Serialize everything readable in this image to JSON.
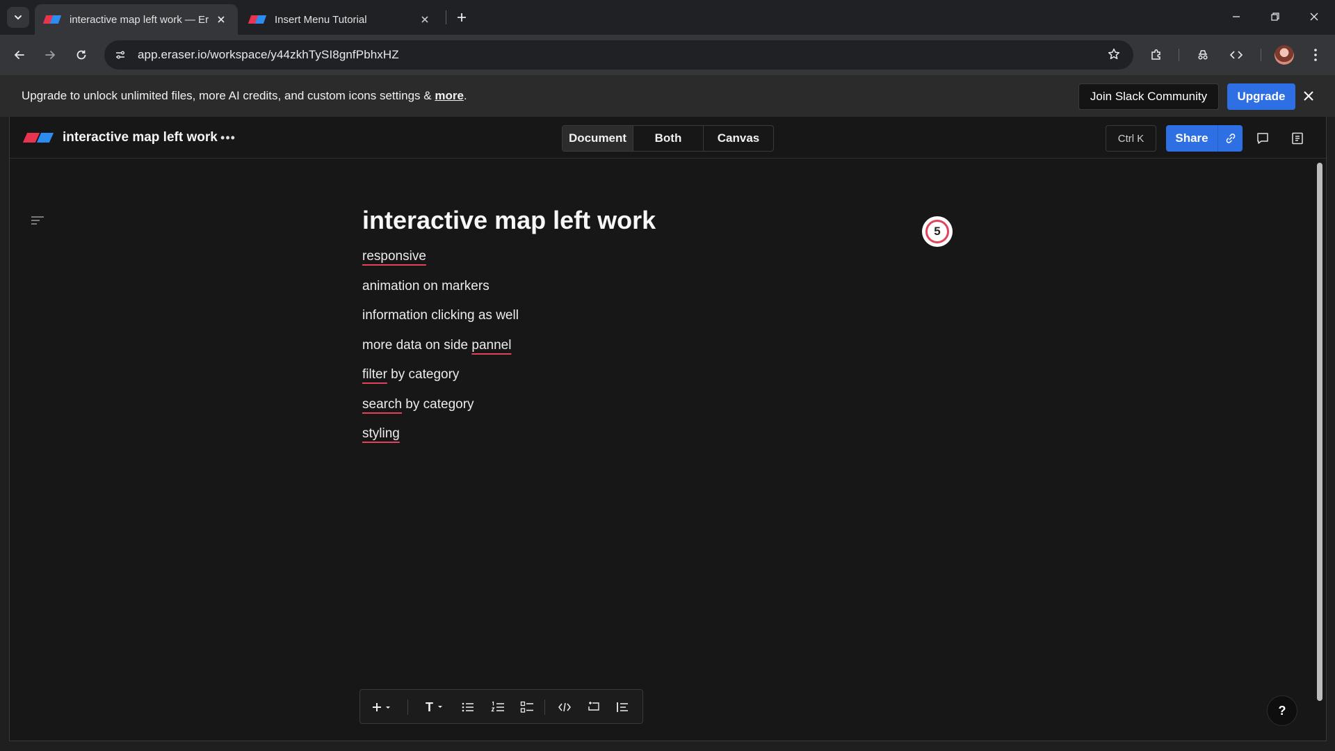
{
  "browser": {
    "tabs": [
      {
        "title": "interactive map left work — Era",
        "active": true
      },
      {
        "title": "Insert Menu Tutorial",
        "active": false
      }
    ],
    "url": "app.eraser.io/workspace/y44zkhTySI8gnfPbhxHZ"
  },
  "banner": {
    "message": "Upgrade to unlock unlimited files, more AI credits, and custom icons settings & ",
    "link_text": "more",
    "message_end": ".",
    "slack_label": "Join Slack Community",
    "upgrade_label": "Upgrade"
  },
  "header": {
    "file_title": "interactive map left work",
    "more_label": "•••",
    "views": [
      "Document",
      "Both",
      "Canvas"
    ],
    "selected_view": "Document",
    "shortcut_label": "Ctrl K",
    "share_label": "Share"
  },
  "document": {
    "title": "interactive map left work",
    "lines": [
      {
        "text": "",
        "misspelled": "responsive",
        "rest": ""
      },
      {
        "text": "animation on markers"
      },
      {
        "text": "information clicking as well"
      },
      {
        "text": "more data on side ",
        "misspelled": "pannel",
        "rest": ""
      },
      {
        "text": "",
        "misspelled": "filter",
        "rest": " by category"
      },
      {
        "text": "",
        "misspelled": "search",
        "rest": " by category"
      },
      {
        "text": "",
        "misspelled": "styling",
        "rest": ""
      }
    ]
  },
  "badge_count": "5",
  "format_toolbar": {
    "items": [
      "insert-icon",
      "text-style-icon",
      "bullet-list-icon",
      "numbered-list-icon",
      "checklist-icon",
      "code-icon",
      "embed-icon",
      "quote-icon"
    ],
    "text_label": "T"
  },
  "help_label": "?",
  "colors": {
    "accent_blue": "#2f6fe4",
    "logo_red": "#e8344e",
    "logo_blue": "#2d8cf0",
    "spell_underline": "#e0435b",
    "background": "#171717"
  }
}
